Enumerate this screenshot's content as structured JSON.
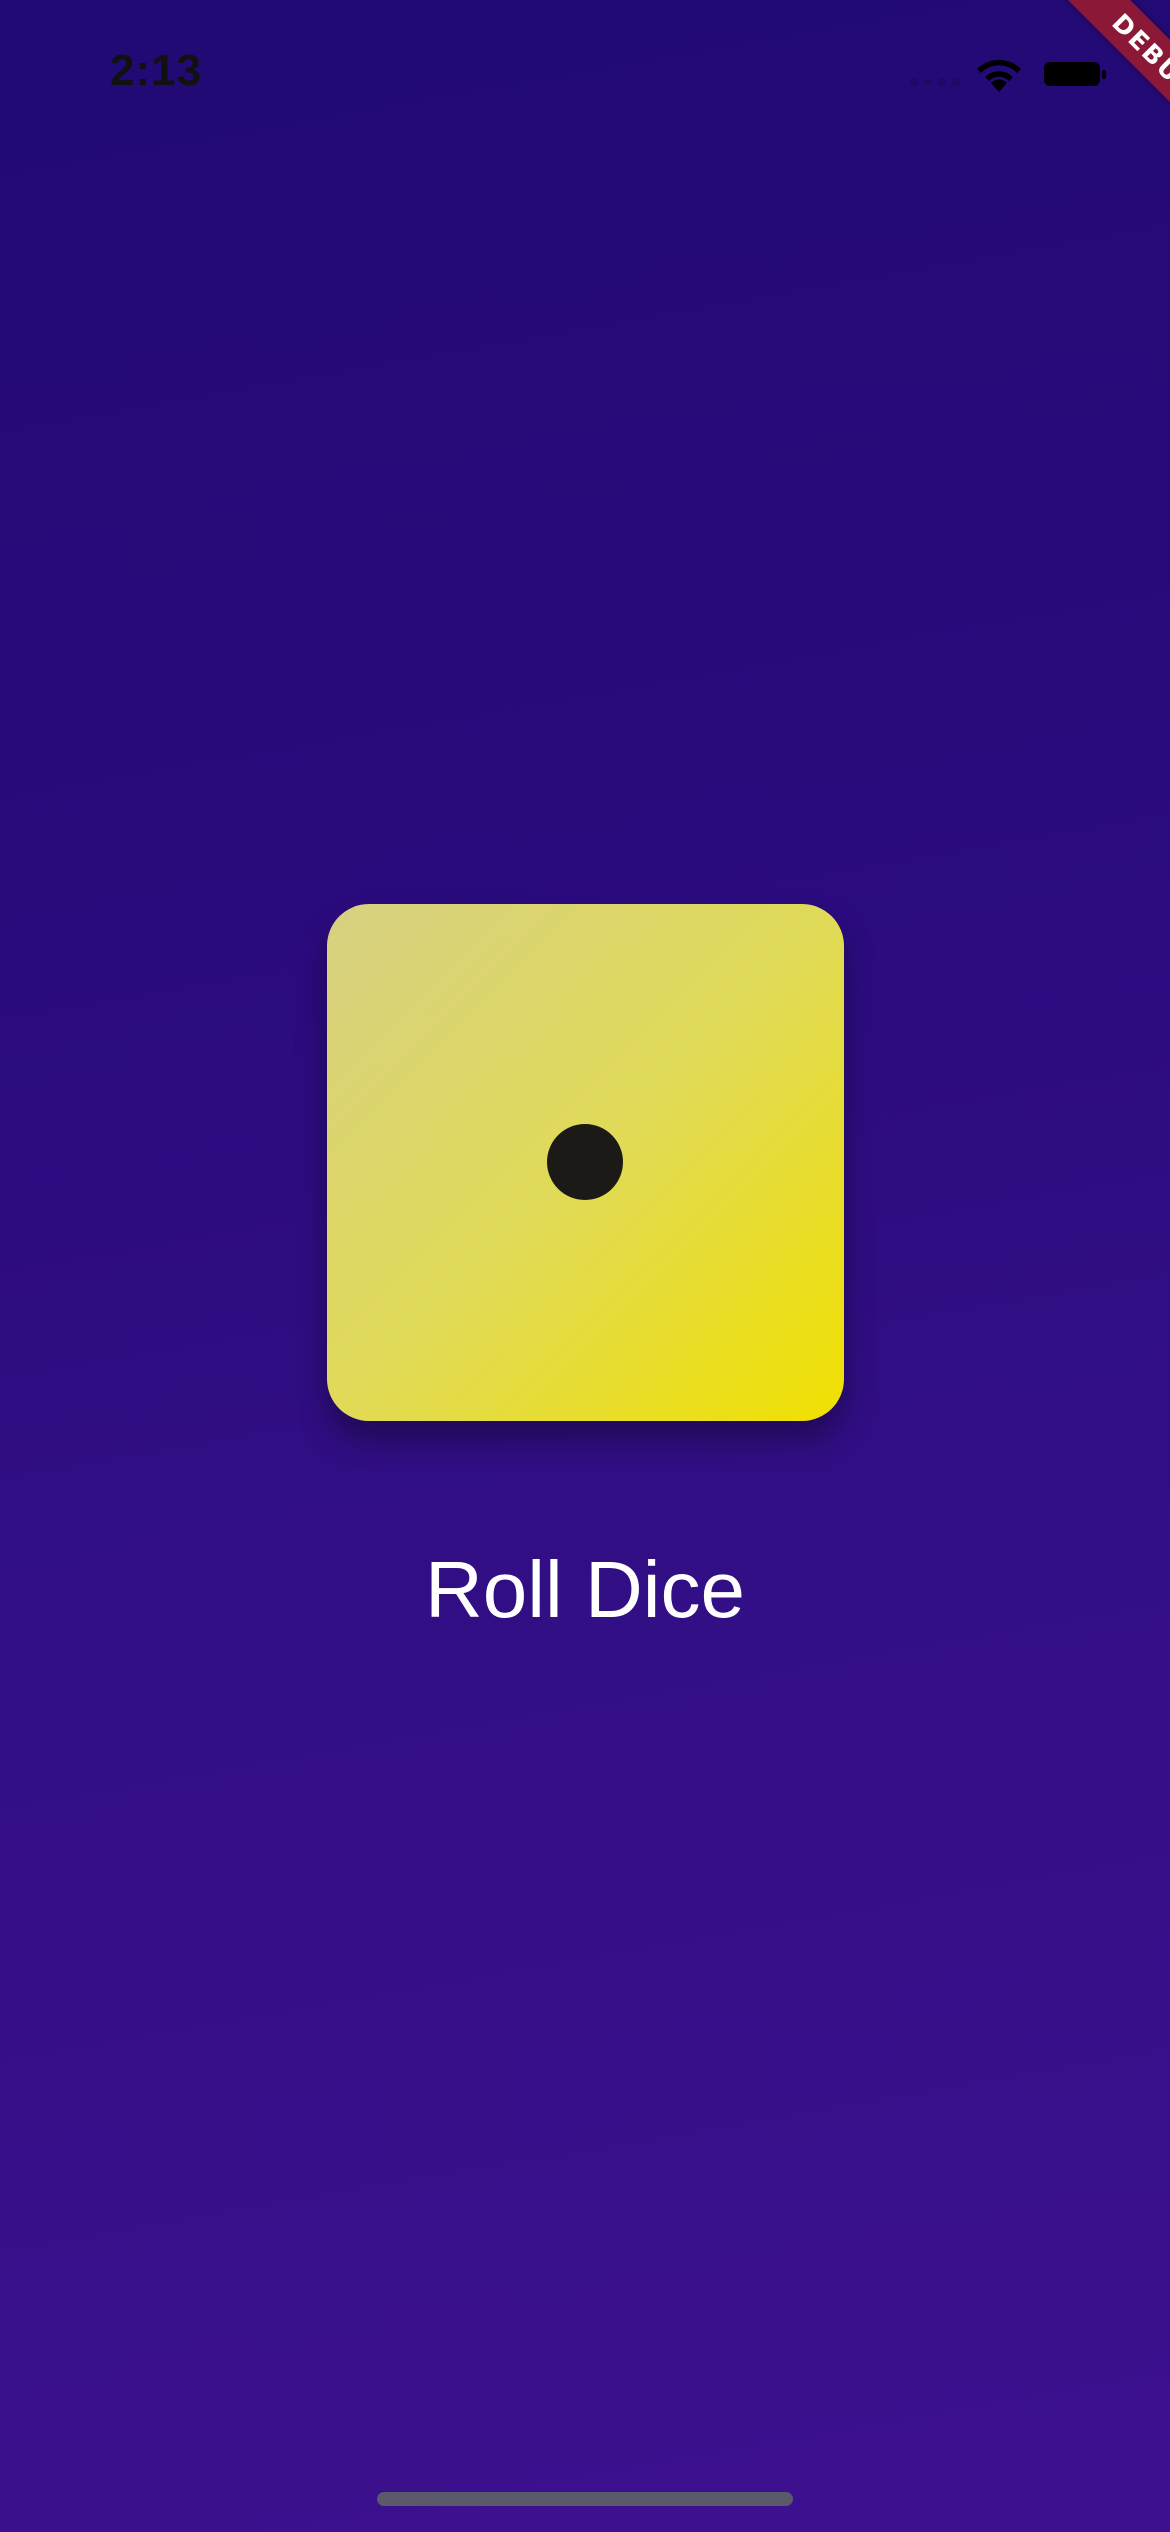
{
  "status_bar": {
    "time": "2:13",
    "icons": [
      "signal-icon",
      "wifi-icon",
      "battery-icon"
    ]
  },
  "debug_banner": {
    "label": "DEBUG",
    "color": "#8b1836"
  },
  "dice": {
    "face_value": 1,
    "face_color_start": "#d7d082",
    "face_color_end": "#f0e000",
    "pip_color": "#1b1a16"
  },
  "roll_button": {
    "label": "Roll Dice"
  },
  "theme": {
    "background_top": "#210a73",
    "background_bottom": "#3d108f",
    "text_color": "#ffffff"
  }
}
